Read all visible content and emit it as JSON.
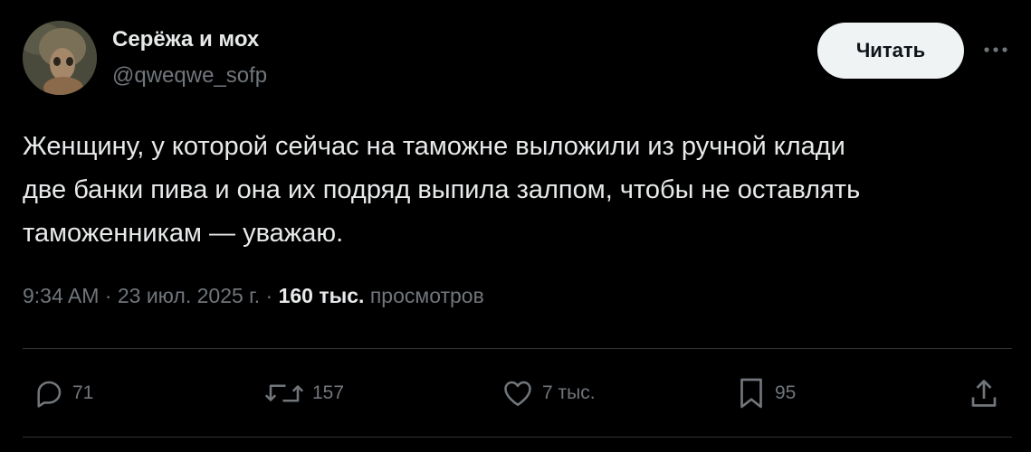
{
  "author": {
    "display_name": "Серёжа и мох",
    "handle": "@qweqwe_sofp"
  },
  "follow_label": "Читать",
  "text_lines": [
    "Женщину, у которой сейчас на таможне выложили из ручной клади",
    "две банки пива и она их подряд выпила залпом, чтобы не оставлять",
    "таможенникам — уважаю."
  ],
  "meta": {
    "time": "9:34 AM",
    "sep1": " · ",
    "date": "23 июл. 2025 г.",
    "sep2": " · ",
    "views_count": "160 тыс.",
    "views_label": " просмотров"
  },
  "actions": {
    "replies": "71",
    "reposts": "157",
    "likes": "7 тыс.",
    "bookmarks": "95"
  },
  "icons": [
    "reply-icon",
    "repost-icon",
    "like-icon",
    "bookmark-icon",
    "share-icon",
    "more-icon"
  ],
  "colors": {
    "background": "#000000",
    "text": "#e7e9ea",
    "secondary": "#71767b",
    "button_bg": "#eff3f4",
    "divider": "#2f3336"
  }
}
